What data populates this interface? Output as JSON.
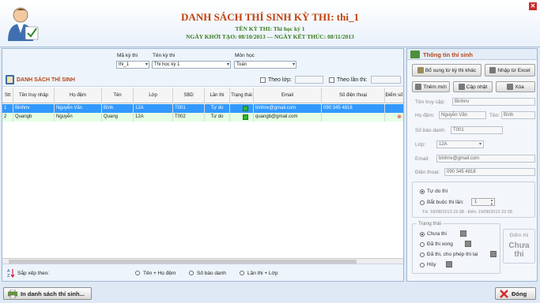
{
  "header": {
    "title": "DANH SÁCH THÍ SINH KỲ THI: thi_1",
    "subtitle": "TÊN KỲ THI: Thi học kỳ 1",
    "dates": "NGÀY KHỞI TẠO: 08/10/2013 --- NGÀY KẾT THÚC: 08/11/2013",
    "close": "✕"
  },
  "filters": {
    "exam_code_label": "Mã kỳ thi",
    "exam_code_value": "thi_1",
    "exam_name_label": "Tên kỳ thi",
    "exam_name_value": "Thi học kỳ 1",
    "subject_label": "Môn học",
    "subject_value": "Toán"
  },
  "list": {
    "title": "DANH SÁCH THÍ SINH",
    "by_class_label": "Theo lớp:",
    "by_attempt_label": "Theo lần thi:"
  },
  "grid": {
    "columns": [
      "Stt",
      "Tên truy nhập",
      "Họ đệm",
      "Tên",
      "Lớp",
      "SBD",
      "Lần thi",
      "Trạng thái",
      "Email",
      "Số điện thoại",
      "Điểm số"
    ],
    "rows": [
      {
        "stt": "1",
        "user": "Binhnv",
        "middle": "Nguyễn Văn",
        "name": "Bình",
        "cls": "12A",
        "sbd": "T001",
        "attempt": "Tự do",
        "email": "binhnv@gmail.com",
        "phone": "090 345 4818",
        "status_color": "#2eb82e"
      },
      {
        "stt": "2",
        "user": "Quangb",
        "middle": "Nguyễn",
        "name": "Quang",
        "cls": "12A",
        "sbd": "T002",
        "attempt": "Tự do",
        "email": "quangb@gmail.com",
        "phone": "",
        "status_color": "#2eb82e"
      }
    ]
  },
  "sort": {
    "label": "Sắp xếp theo:",
    "options": [
      "Tên + Họ đệm",
      "Số báo danh",
      "Lần thi + Lớp"
    ]
  },
  "detail": {
    "title": "Thông tin thí sinh",
    "btn_import_other": "Bổ sung từ kỳ thi khác",
    "btn_import_excel": "Nhập từ Excel",
    "btn_add": "Thêm mới",
    "btn_update": "Cập nhật",
    "btn_delete": "Xóa",
    "user_label": "Tên truy cập:",
    "user_value": "Binhnv",
    "middle_label": "Họ đệm:",
    "middle_value": "Nguyễn Văn",
    "name_label": "Tên:",
    "name_value": "Bình",
    "sbd_label": "Số báo danh:",
    "sbd_value": "T001",
    "class_label": "Lớp:",
    "class_value": "12A",
    "email_label": "Email:",
    "email_value": "binhnv@gmail.com",
    "phone_label": "Điện thoại:",
    "phone_value": "090 345 4818",
    "mode_free": "Tự do thi",
    "mode_required": "Bắt buộc thi lần:",
    "attempt_value": "1",
    "date_range": "Từ: 18/08/2013  22:38 - Đến: 19/08/2013  22:38",
    "status_group": "Trạng thái",
    "status_options": [
      "Chưa thi",
      "Đã thi xong",
      "Đã thi, cho phép thi lại",
      "Hủy"
    ],
    "score_label": "Điểm thi",
    "score_value": "Chưa thi"
  },
  "footer": {
    "print_button": "In danh sách thí sinh...",
    "close_button": "Đóng"
  }
}
